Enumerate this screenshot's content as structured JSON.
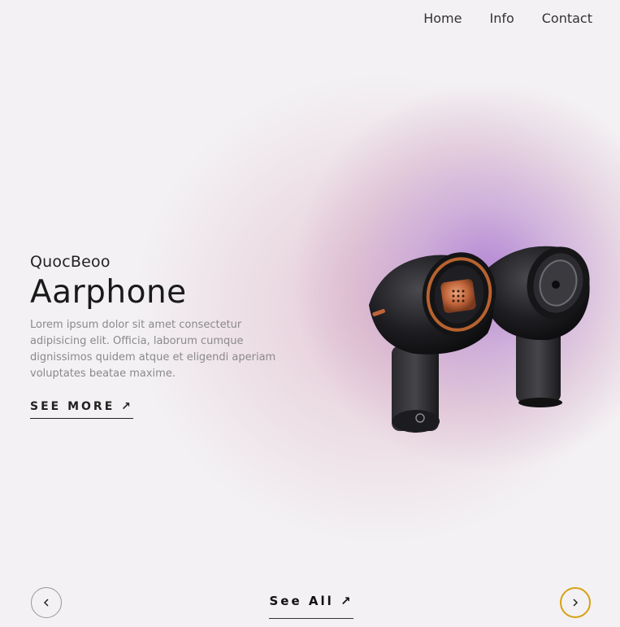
{
  "nav": {
    "items": [
      {
        "label": "Home"
      },
      {
        "label": "Info"
      },
      {
        "label": "Contact"
      }
    ]
  },
  "hero": {
    "brand": "QuocBeoo",
    "title": "Aarphone",
    "description": "Lorem ipsum dolor sit amet consectetur adipisicing elit. Officia, laborum cumque dignissimos quidem atque et eligendi aperiam voluptates beatae maxime.",
    "see_more": "SEE MORE ↗"
  },
  "footer": {
    "see_all": "See All ↗",
    "prev_icon": "chevron-left-icon",
    "next_icon": "chevron-right-icon"
  },
  "colors": {
    "accent": "#d7a111",
    "glow": "#a878d2"
  }
}
